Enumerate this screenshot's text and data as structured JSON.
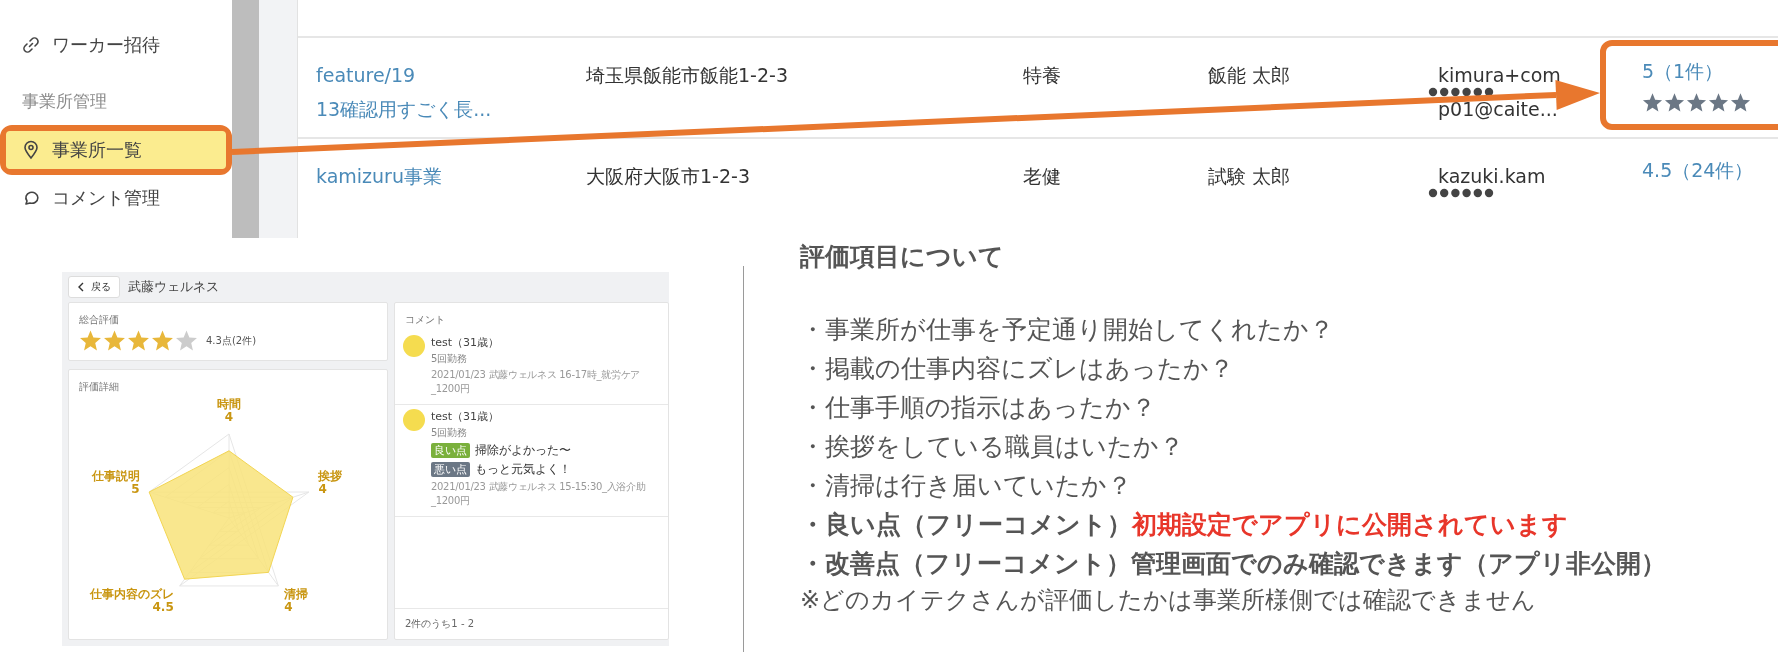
{
  "sidebar": {
    "items": [
      {
        "kind": "link",
        "label": "ワーカー招待",
        "selected": false
      },
      {
        "kind": "heading",
        "label": "事業所管理"
      },
      {
        "kind": "place",
        "label": "事業所一覧",
        "selected": true,
        "annotated": true
      },
      {
        "kind": "chat",
        "label": "コメント管理",
        "selected": false
      }
    ]
  },
  "table": {
    "rows": [
      {
        "name": "feature/19\n13確認用すごく長...",
        "address": "埼玉県飯能市飯能1-2-3",
        "type": "特養",
        "person": "飯能 太郎",
        "email": "kimura+com\np01@caite...",
        "email_redacted": true,
        "rating": "5（1件）",
        "stars": 5,
        "annotated": true
      },
      {
        "name": "kamizuru事業",
        "address": "大阪府大阪市1-2-3",
        "type": "老健",
        "person": "試験 太郎",
        "email": "kazuki.kam",
        "email_redacted": true,
        "rating": "4.5（24件）",
        "annotated": false
      }
    ]
  },
  "screenshot": {
    "back_button": "戻る",
    "title": "武藤ウェルネス",
    "overall": {
      "label": "総合評価",
      "stars": 4,
      "score": "4.3点(2件)"
    },
    "detail": {
      "label": "評価詳細",
      "axes": [
        {
          "label": "時間",
          "value": "4"
        },
        {
          "label": "仕事説明",
          "value": "5"
        },
        {
          "label": "挨拶",
          "value": "4"
        },
        {
          "label": "仕事内容のズレ",
          "value": "4.5"
        },
        {
          "label": "清掃",
          "value": "4"
        }
      ]
    },
    "comments": {
      "title": "コメント",
      "items": [
        {
          "author": "test（31歳）",
          "visits": "5回勤務",
          "meta": "2021/01/23 武藤ウェルネス 16-17時_就労ケア_1200円"
        },
        {
          "author": "test（31歳）",
          "visits": "5回勤務",
          "remarks": [
            {
              "tag": "良い点",
              "color": "#7ab03c",
              "text": "掃除がよかった〜"
            },
            {
              "tag": "悪い点",
              "color": "#6b7785",
              "text": "もっと元気よく！"
            }
          ],
          "meta": "2021/01/23 武藤ウェルネス 15-15:30_入浴介助_1200円"
        }
      ],
      "footer": "2件のうち1 - 2"
    }
  },
  "notes": {
    "title": "評価項目について",
    "lines": [
      {
        "text": "・事業所が仕事を予定通り開始してくれたか？",
        "bold": false
      },
      {
        "text": "・掲載の仕事内容にズレはあったか？",
        "bold": false
      },
      {
        "text": "・仕事手順の指示はあったか？",
        "bold": false
      },
      {
        "text": "・挨拶をしている職員はいたか？",
        "bold": false
      },
      {
        "text": "・清掃は行き届いていたか？",
        "bold": false
      },
      {
        "text": "・良い点（フリーコメント）",
        "bold": true,
        "note": "初期設定でアプリに公開されています",
        "alert": true
      },
      {
        "text": "・改善点（フリーコメント）",
        "bold": true,
        "note": "管理画面でのみ確認できます（アプリ非公開）",
        "alert": false
      }
    ],
    "footnote": "※どのカイテクさんが評価したかは事業所様側では確認できません"
  }
}
